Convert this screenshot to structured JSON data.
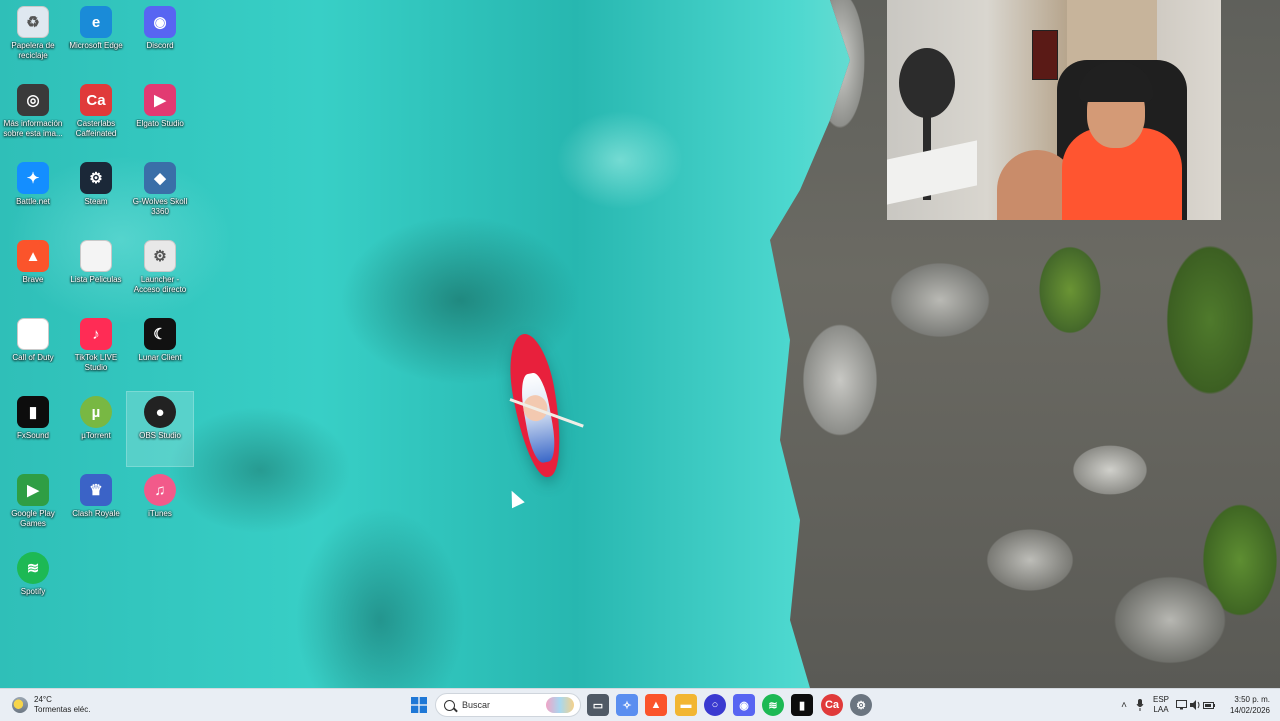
{
  "desktop": {
    "icons": [
      {
        "label": "Papelera de reciclaje",
        "icon": "recycle-bin-icon",
        "color": "#dfe8f0"
      },
      {
        "label": "Microsoft Edge",
        "icon": "edge-icon",
        "color": "#1a8bd8"
      },
      {
        "label": "Discord",
        "icon": "discord-icon",
        "color": "#5865f2"
      },
      {
        "label": "Más información sobre esta ima...",
        "icon": "info-camera-icon",
        "color": "#3a3a3a"
      },
      {
        "label": "Casterlabs Caffeinated",
        "icon": "casterlabs-icon",
        "color": "#e03a3a"
      },
      {
        "label": "Elgato Studio",
        "icon": "elgato-icon",
        "color": "#e23a72"
      },
      {
        "label": "Battle.net",
        "icon": "battlenet-icon",
        "color": "#148eff"
      },
      {
        "label": "Steam",
        "icon": "steam-icon",
        "color": "#1b2838"
      },
      {
        "label": "G-Wolves Skoll 3360",
        "icon": "gwolves-icon",
        "color": "#3a6fa8"
      },
      {
        "label": "Brave",
        "icon": "brave-icon",
        "color": "#fb542b"
      },
      {
        "label": "Lista Peliculas",
        "icon": "document-icon",
        "color": "#f4f4f4"
      },
      {
        "label": "Launcher - Acceso directo",
        "icon": "launcher-shortcut-icon",
        "color": "#e8e8e8"
      },
      {
        "label": "Call of Duty",
        "icon": "document-icon",
        "color": "#ffffff"
      },
      {
        "label": "TikTok LIVE Studio",
        "icon": "tiktok-live-icon",
        "color": "#ff2c55"
      },
      {
        "label": "Lunar Client",
        "icon": "lunar-client-icon",
        "color": "#111111"
      },
      {
        "label": "FxSound",
        "icon": "fxsound-icon",
        "color": "#0d0d0d"
      },
      {
        "label": "µTorrent",
        "icon": "utorrent-icon",
        "color": "#78b843"
      },
      {
        "label": "OBS Studio",
        "icon": "obs-icon",
        "color": "#222222"
      },
      {
        "label": "Google Play Games",
        "icon": "google-play-games-icon",
        "color": "#2f9e44"
      },
      {
        "label": "Clash Royale",
        "icon": "clash-royale-icon",
        "color": "#3b63c7"
      },
      {
        "label": "iTunes",
        "icon": "itunes-icon",
        "color": "#f25a8a"
      },
      {
        "label": "Spotify",
        "icon": "spotify-icon",
        "color": "#1db954"
      }
    ]
  },
  "webcam": {
    "label": "webcam-overlay"
  },
  "taskbar": {
    "weather": {
      "temperature": "24°C",
      "condition": "Tormentas eléc."
    },
    "start_icon": "windows-start-icon",
    "search": {
      "placeholder": "Buscar"
    },
    "pinned": [
      {
        "icon": "task-view-icon",
        "color": "#505a66"
      },
      {
        "icon": "copilot-icon",
        "color": "#5a8ef0"
      },
      {
        "icon": "brave-icon",
        "color": "#fb542b"
      },
      {
        "icon": "file-explorer-icon",
        "color": "#f2b632"
      },
      {
        "icon": "cortana-icon",
        "color": "#3a3ad0"
      },
      {
        "icon": "discord-icon",
        "color": "#5865f2"
      },
      {
        "icon": "spotify-icon",
        "color": "#1db954"
      },
      {
        "icon": "fxsound-icon",
        "color": "#0d0d0d"
      },
      {
        "icon": "casterlabs-icon",
        "color": "#e03a3a"
      },
      {
        "icon": "settings-icon",
        "color": "#6b7580"
      }
    ],
    "tray": {
      "lang_top": "ESP",
      "lang_bottom": "LAA"
    },
    "clock": {
      "time": "3:50 p. m.",
      "date": "14/02/2026"
    }
  }
}
